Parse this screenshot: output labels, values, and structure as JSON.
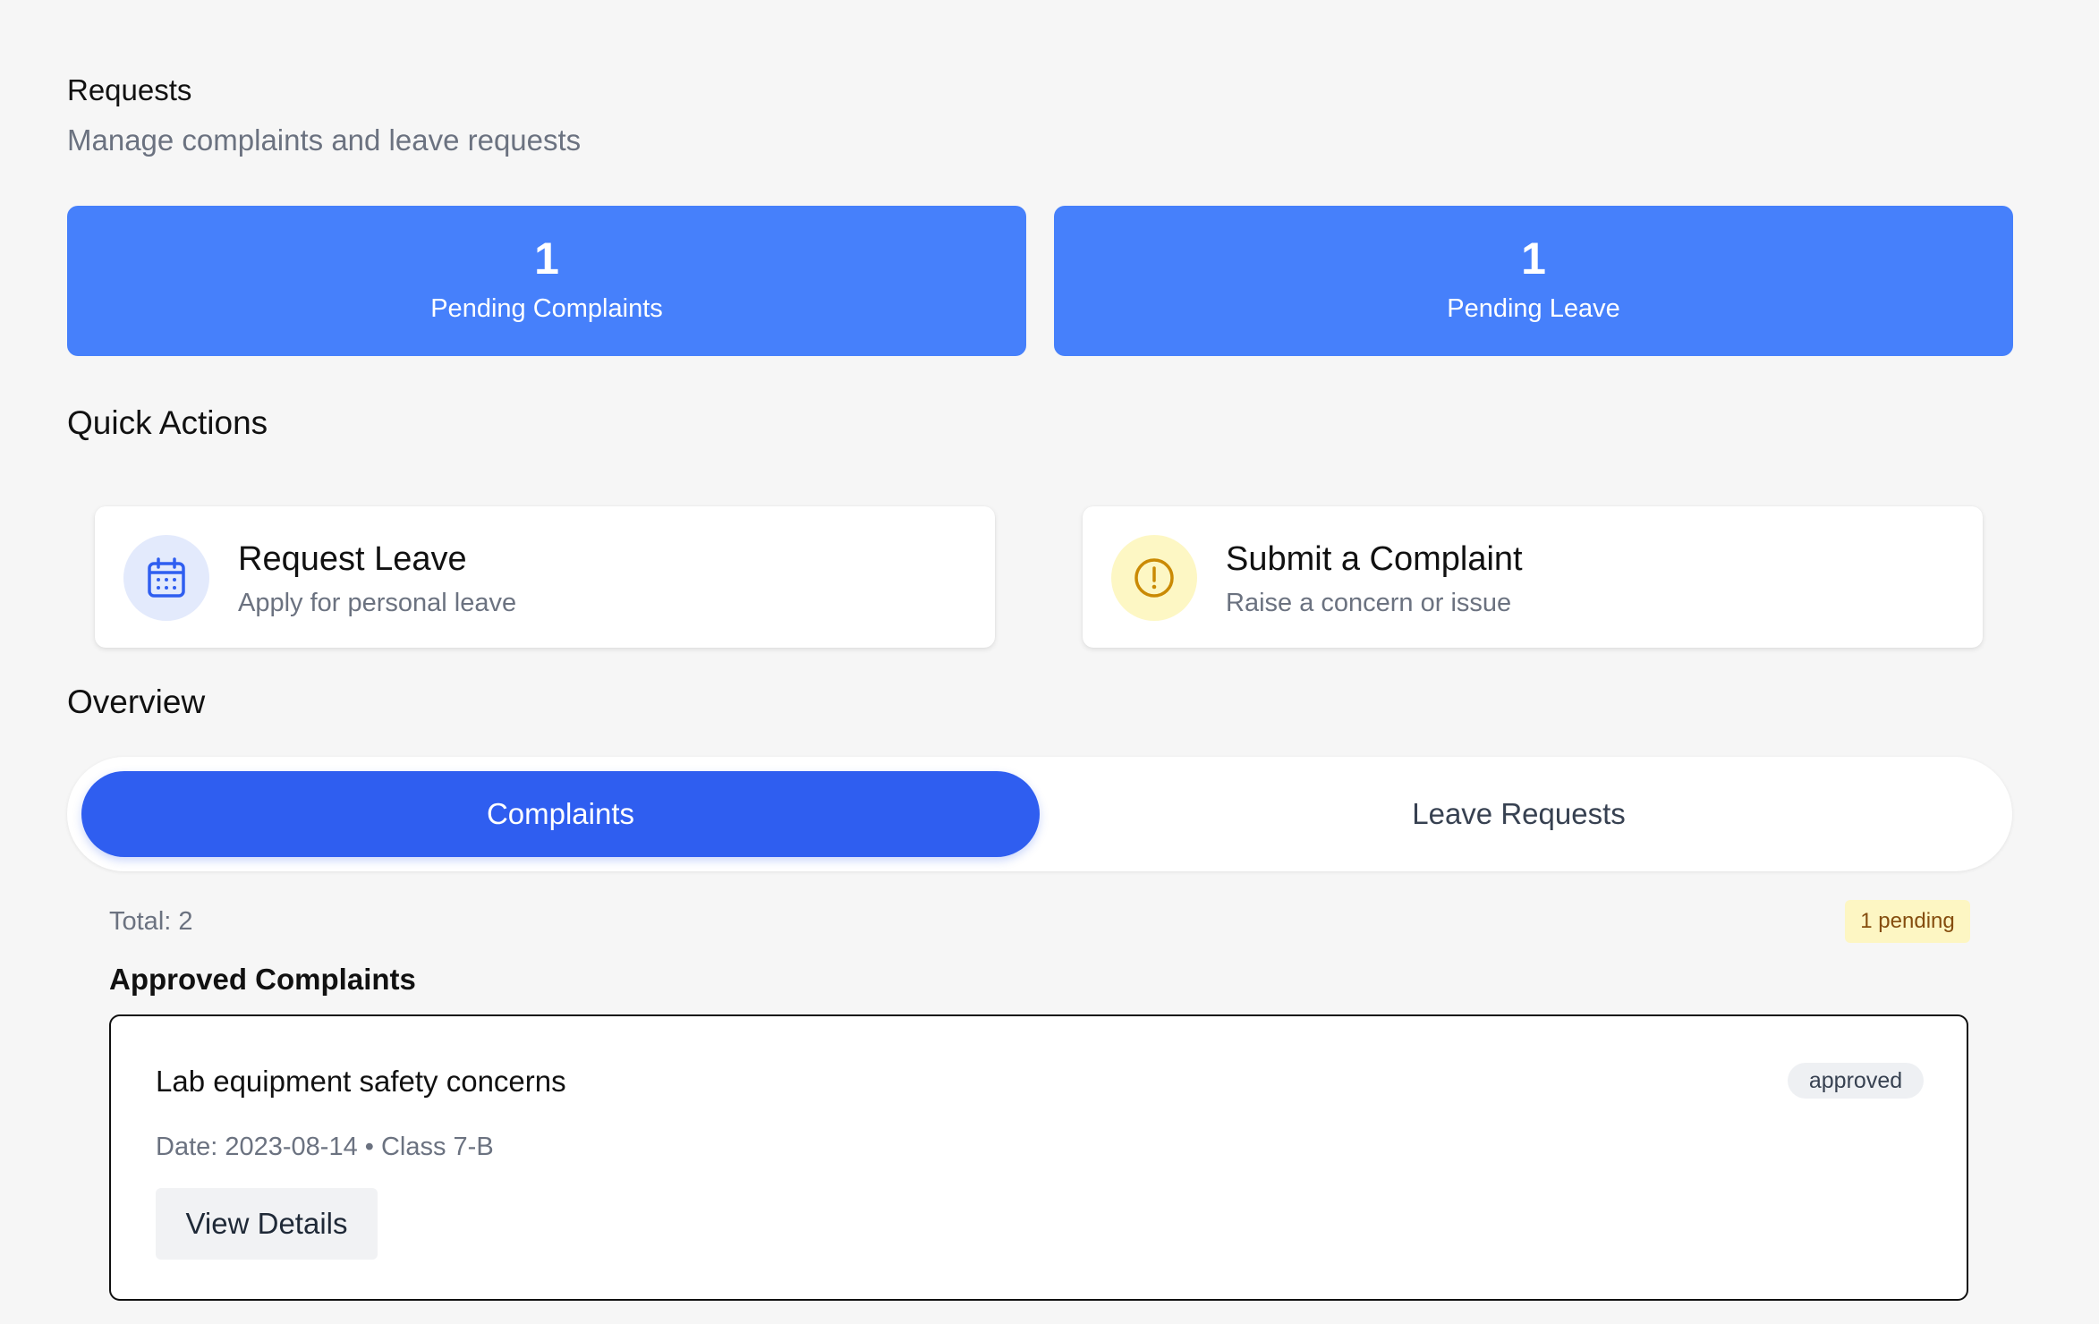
{
  "header": {
    "title": "Requests",
    "subtitle": "Manage complaints and leave requests"
  },
  "stats": [
    {
      "value": "1",
      "label": "Pending Complaints"
    },
    {
      "value": "1",
      "label": "Pending Leave"
    }
  ],
  "quick_actions": {
    "heading": "Quick Actions",
    "items": [
      {
        "title": "Request Leave",
        "description": "Apply for personal leave",
        "icon": "calendar-icon"
      },
      {
        "title": "Submit a Complaint",
        "description": "Raise a concern or issue",
        "icon": "alert-circle-icon"
      }
    ]
  },
  "overview": {
    "heading": "Overview",
    "tabs": [
      {
        "label": "Complaints",
        "active": true
      },
      {
        "label": "Leave Requests",
        "active": false
      }
    ],
    "total_text": "Total: 2",
    "pending_badge": "1 pending",
    "section_heading": "Approved Complaints",
    "complaints": [
      {
        "title": "Lab equipment safety concerns",
        "status": "approved",
        "meta": "Date: 2023-08-14 • Class 7-B",
        "action_label": "View Details"
      }
    ]
  },
  "colors": {
    "background": "#f6f6f6",
    "stat_card": "#4680fb",
    "active_tab": "#2f5ef0",
    "pending_badge_bg": "#fdf6c3",
    "calendar_icon_bg": "#e3eafc",
    "complaint_icon_bg": "#fdf7c4"
  }
}
